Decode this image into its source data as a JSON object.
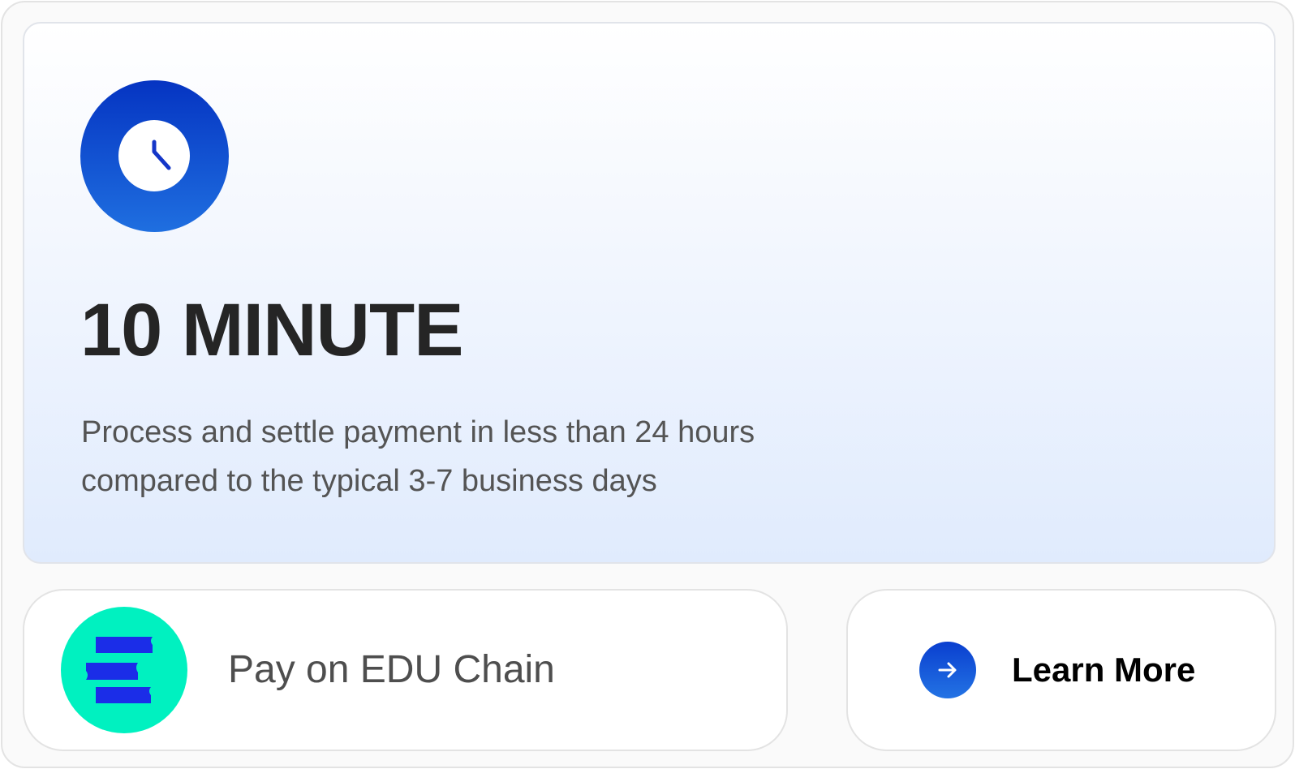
{
  "hero": {
    "title": "10 MINUTE",
    "description_line1": "Process and settle payment in less than 24 hours",
    "description_line2": "compared to the typical 3-7 business days",
    "icon": "clock-icon",
    "accent_color": "#0534c2"
  },
  "pay": {
    "label": "Pay on EDU Chain",
    "logo_icon": "edu-chain-books-icon",
    "logo_color": "#00f1c0",
    "logo_mark_color": "#1b2de8"
  },
  "learn": {
    "label": "Learn More",
    "icon": "arrow-right-icon"
  }
}
